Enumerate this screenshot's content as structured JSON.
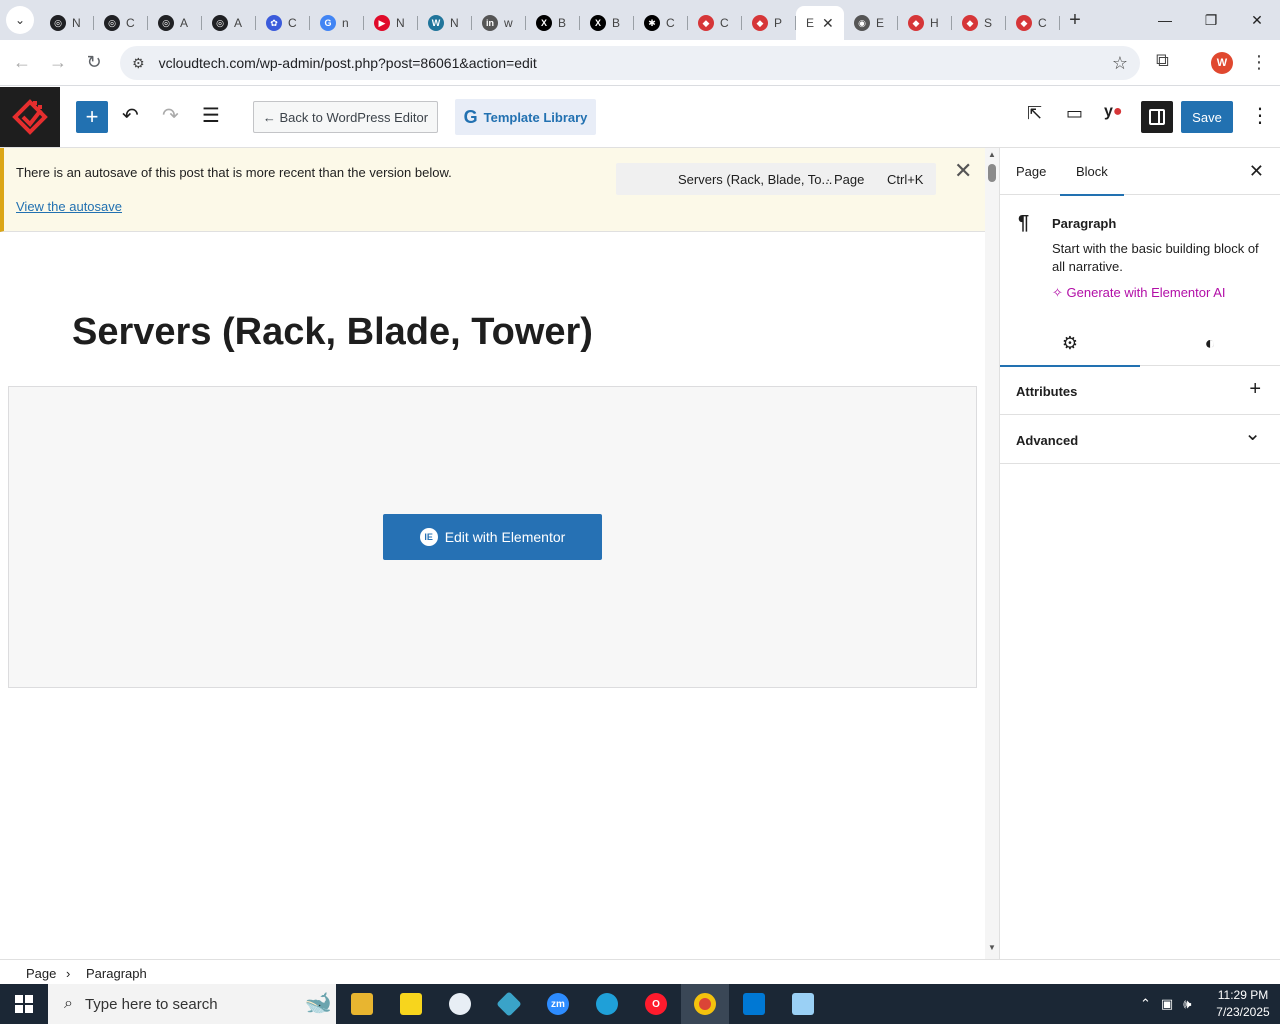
{
  "browser": {
    "tabs": [
      {
        "letter": "N",
        "color": "#202124",
        "glyph": "◎"
      },
      {
        "letter": "C",
        "color": "#202124",
        "glyph": "◎"
      },
      {
        "letter": "A",
        "color": "#202124",
        "glyph": "◎"
      },
      {
        "letter": "A",
        "color": "#202124",
        "glyph": "◎"
      },
      {
        "letter": "C",
        "color": "#3b5bdb",
        "glyph": "✿"
      },
      {
        "letter": "n",
        "color": "#4285f4",
        "glyph": "G"
      },
      {
        "letter": "N",
        "color": "#e00b2a",
        "glyph": "▶"
      },
      {
        "letter": "N",
        "color": "#21759b",
        "glyph": "W"
      },
      {
        "letter": "w",
        "color": "#555555",
        "glyph": "in"
      },
      {
        "letter": "B",
        "color": "#000000",
        "glyph": "X"
      },
      {
        "letter": "B",
        "color": "#000000",
        "glyph": "X"
      },
      {
        "letter": "C",
        "color": "#000000",
        "glyph": "✱"
      },
      {
        "letter": "C",
        "color": "#d63638",
        "glyph": "◆"
      },
      {
        "letter": "P",
        "color": "#d63638",
        "glyph": "◆"
      },
      {
        "letter": "E",
        "color": "#ffffff",
        "glyph": "",
        "active": true
      },
      {
        "letter": "E",
        "color": "#555555",
        "glyph": "◉"
      },
      {
        "letter": "H",
        "color": "#d63638",
        "glyph": "◆"
      },
      {
        "letter": "S",
        "color": "#d63638",
        "glyph": "◆"
      },
      {
        "letter": "C",
        "color": "#d63638",
        "glyph": "◆"
      }
    ],
    "url": "vcloudtech.com/wp-admin/post.php?post=86061&action=edit",
    "profile_initial": "W"
  },
  "editor": {
    "back_label": "← Back to WordPress Editor",
    "template_label": "Template Library",
    "save_label": "Save",
    "notice_message": "There is an autosave of this post that is more recent than the version below.",
    "notice_link": "View the autosave",
    "command_title": "Servers (Rack, Blade, To...",
    "command_kind": "· Page",
    "command_shortcut": "Ctrl+K",
    "post_title": "Servers (Rack, Blade, Tower)",
    "elementor_button": "Edit with Elementor"
  },
  "sidebar": {
    "tab_page": "Page",
    "tab_block": "Block",
    "block_name": "Paragraph",
    "block_desc": "Start with the basic building block of all narrative.",
    "ai_link": "Generate with Elementor AI",
    "panels": [
      {
        "label": "Attributes",
        "control": "+"
      },
      {
        "label": "Advanced",
        "control": "⌄"
      }
    ]
  },
  "footer": {
    "crumb_root": "Page",
    "crumb_sep": "›",
    "crumb_leaf": "Paragraph"
  },
  "taskbar": {
    "search_placeholder": "Type here to search",
    "time": "11:29 PM",
    "date": "7/23/2025"
  },
  "colors": {
    "wp_blue": "#2271b1",
    "notice_bg": "#fcf9e8",
    "elementor_ai": "#b20ea7"
  }
}
